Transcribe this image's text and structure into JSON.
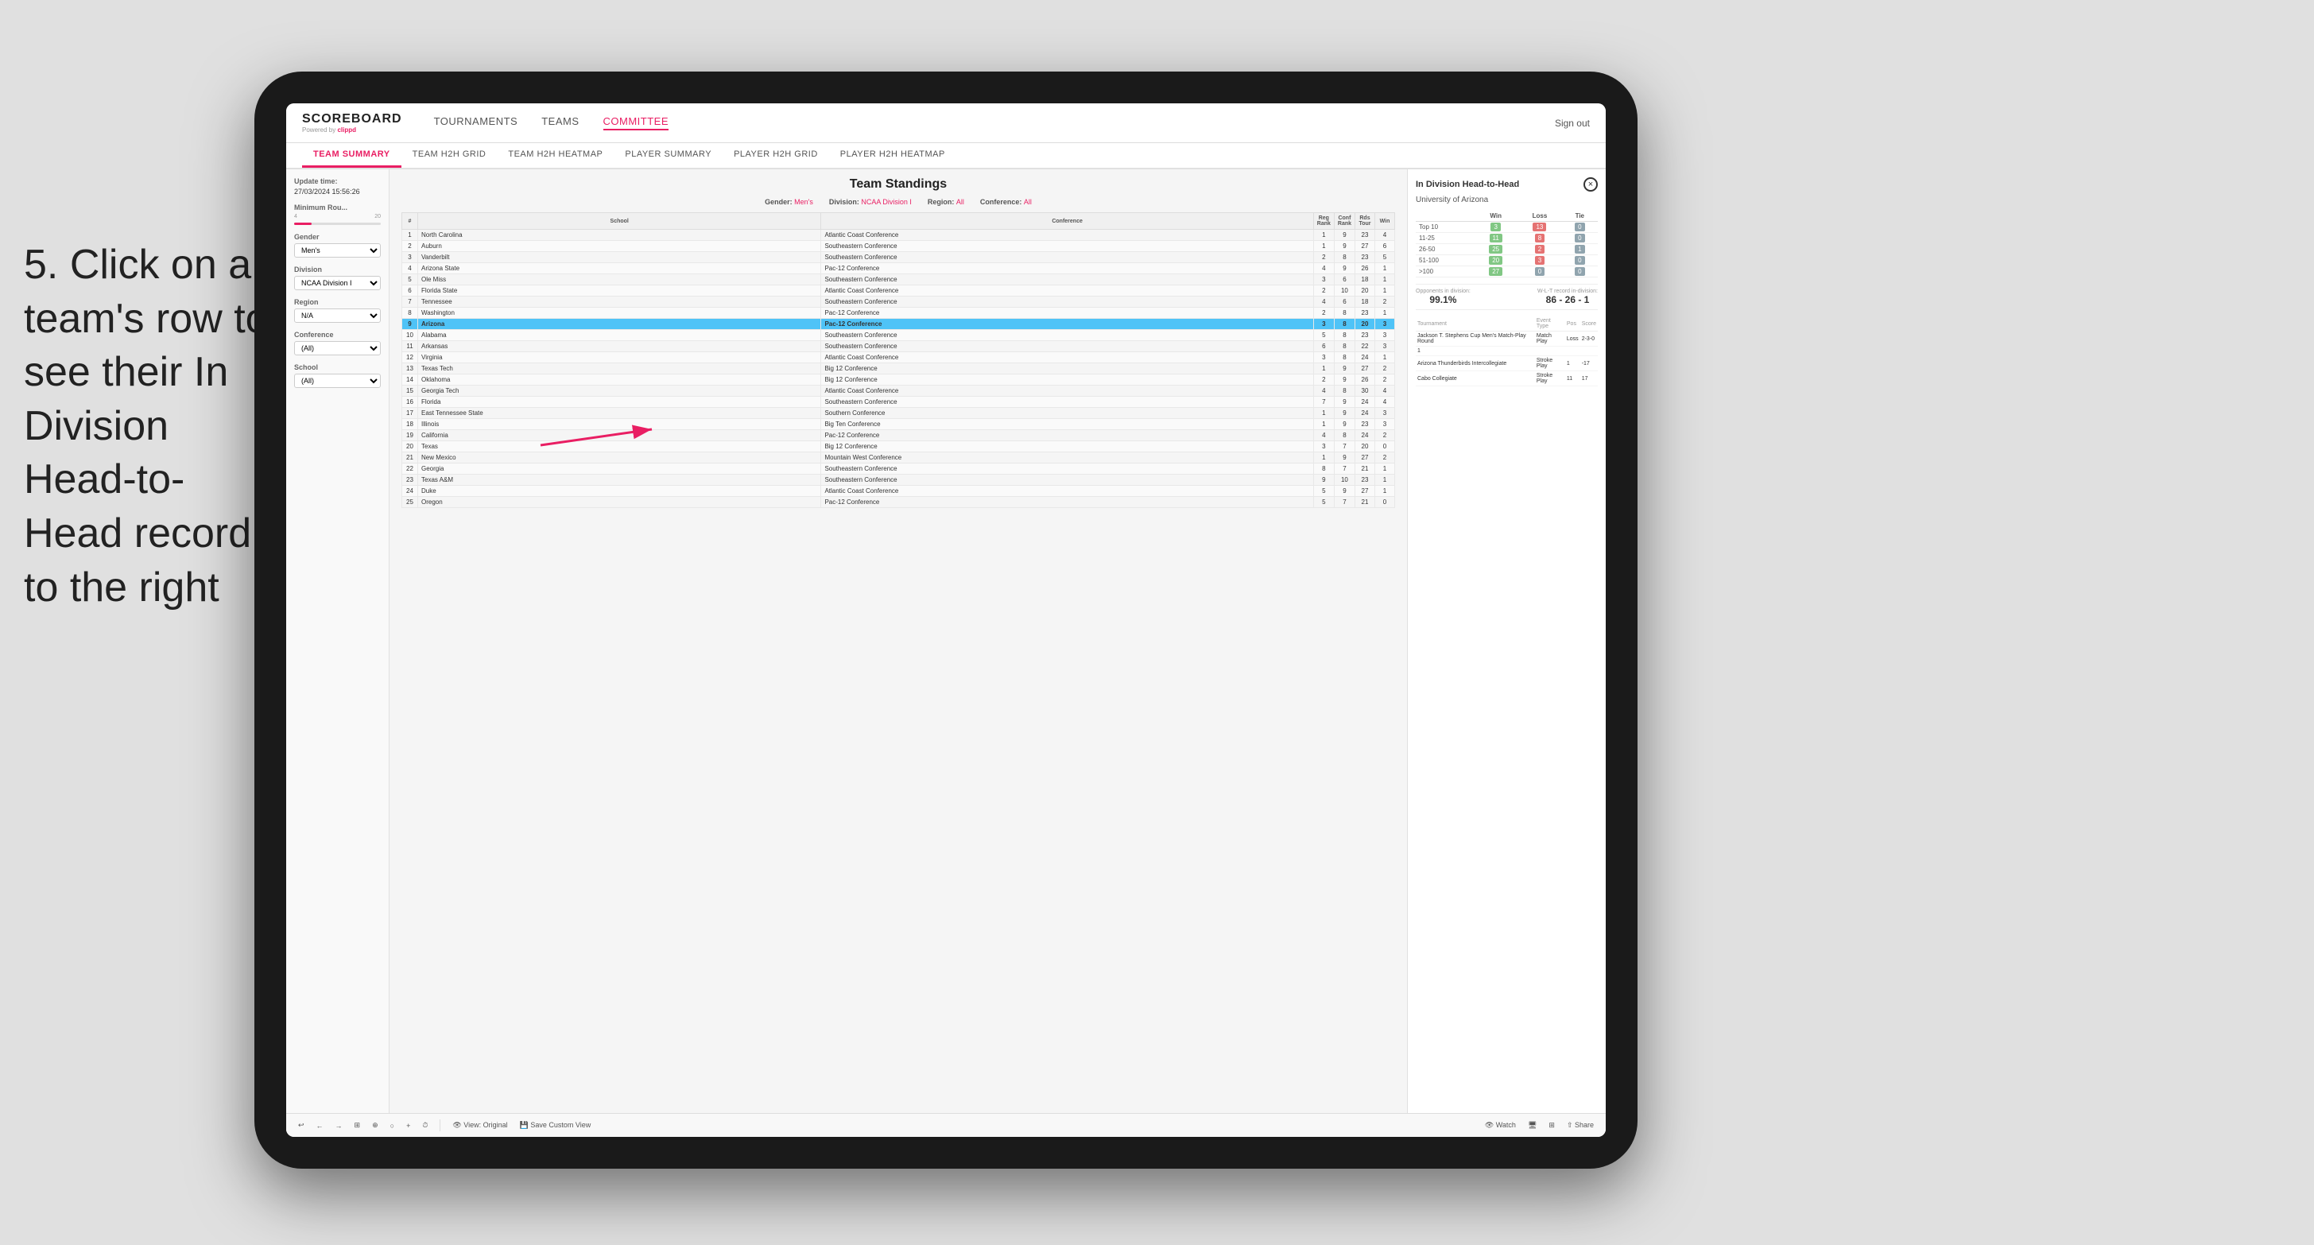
{
  "instruction": {
    "step": "5. Click on a team's row to see their In Division Head-to-Head record to the right"
  },
  "nav": {
    "logo": "SCOREBOARD",
    "logo_sub": "Powered by clippd",
    "links": [
      "TOURNAMENTS",
      "TEAMS",
      "COMMITTEE"
    ],
    "sign_out": "Sign out",
    "active_link": "COMMITTEE"
  },
  "sub_nav": {
    "items": [
      "TEAM SUMMARY",
      "TEAM H2H GRID",
      "TEAM H2H HEATMAP",
      "PLAYER SUMMARY",
      "PLAYER H2H GRID",
      "PLAYER H2H HEATMAP"
    ],
    "active": "TEAM SUMMARY"
  },
  "sidebar": {
    "update_label": "Update time:",
    "update_time": "27/03/2024 15:56:26",
    "min_rounds_label": "Minimum Rou...",
    "min_rounds_min": "4",
    "min_rounds_max": "20",
    "gender_label": "Gender",
    "gender_value": "Men's",
    "division_label": "Division",
    "division_value": "NCAA Division I",
    "region_label": "Region",
    "region_value": "N/A",
    "conference_label": "Conference",
    "conference_value": "(All)",
    "school_label": "School",
    "school_value": "(All)"
  },
  "standings": {
    "title": "Team Standings",
    "gender_label": "Gender:",
    "gender_value": "Men's",
    "division_label": "Division:",
    "division_value": "NCAA Division I",
    "region_label": "Region:",
    "region_value": "All",
    "conference_label": "Conference:",
    "conference_value": "All",
    "columns": [
      "#",
      "School",
      "Conference",
      "Reg Rank",
      "Conf Rank",
      "Rds Tour",
      "Win"
    ],
    "rows": [
      {
        "num": 1,
        "school": "North Carolina",
        "conf": "Atlantic Coast Conference",
        "reg_rank": 1,
        "conf_rank": 9,
        "rds": 23,
        "win": 4
      },
      {
        "num": 2,
        "school": "Auburn",
        "conf": "Southeastern Conference",
        "reg_rank": 1,
        "conf_rank": 9,
        "rds": 27,
        "win": 6
      },
      {
        "num": 3,
        "school": "Vanderbilt",
        "conf": "Southeastern Conference",
        "reg_rank": 2,
        "conf_rank": 8,
        "rds": 23,
        "win": 5
      },
      {
        "num": 4,
        "school": "Arizona State",
        "conf": "Pac-12 Conference",
        "reg_rank": 4,
        "conf_rank": 9,
        "rds": 26,
        "win": 1
      },
      {
        "num": 5,
        "school": "Ole Miss",
        "conf": "Southeastern Conference",
        "reg_rank": 3,
        "conf_rank": 6,
        "rds": 18,
        "win": 1
      },
      {
        "num": 6,
        "school": "Florida State",
        "conf": "Atlantic Coast Conference",
        "reg_rank": 2,
        "conf_rank": 10,
        "rds": 20,
        "win": 1
      },
      {
        "num": 7,
        "school": "Tennessee",
        "conf": "Southeastern Conference",
        "reg_rank": 4,
        "conf_rank": 6,
        "rds": 18,
        "win": 2
      },
      {
        "num": 8,
        "school": "Washington",
        "conf": "Pac-12 Conference",
        "reg_rank": 2,
        "conf_rank": 8,
        "rds": 23,
        "win": 1
      },
      {
        "num": 9,
        "school": "Arizona",
        "conf": "Pac-12 Conference",
        "reg_rank": 3,
        "conf_rank": 8,
        "rds": 20,
        "win": 3,
        "highlighted": true
      },
      {
        "num": 10,
        "school": "Alabama",
        "conf": "Southeastern Conference",
        "reg_rank": 5,
        "conf_rank": 8,
        "rds": 23,
        "win": 3
      },
      {
        "num": 11,
        "school": "Arkansas",
        "conf": "Southeastern Conference",
        "reg_rank": 6,
        "conf_rank": 8,
        "rds": 22,
        "win": 3
      },
      {
        "num": 12,
        "school": "Virginia",
        "conf": "Atlantic Coast Conference",
        "reg_rank": 3,
        "conf_rank": 8,
        "rds": 24,
        "win": 1
      },
      {
        "num": 13,
        "school": "Texas Tech",
        "conf": "Big 12 Conference",
        "reg_rank": 1,
        "conf_rank": 9,
        "rds": 27,
        "win": 2
      },
      {
        "num": 14,
        "school": "Oklahoma",
        "conf": "Big 12 Conference",
        "reg_rank": 2,
        "conf_rank": 9,
        "rds": 26,
        "win": 2
      },
      {
        "num": 15,
        "school": "Georgia Tech",
        "conf": "Atlantic Coast Conference",
        "reg_rank": 4,
        "conf_rank": 8,
        "rds": 30,
        "win": 4
      },
      {
        "num": 16,
        "school": "Florida",
        "conf": "Southeastern Conference",
        "reg_rank": 7,
        "conf_rank": 9,
        "rds": 24,
        "win": 4
      },
      {
        "num": 17,
        "school": "East Tennessee State",
        "conf": "Southern Conference",
        "reg_rank": 1,
        "conf_rank": 9,
        "rds": 24,
        "win": 3
      },
      {
        "num": 18,
        "school": "Illinois",
        "conf": "Big Ten Conference",
        "reg_rank": 1,
        "conf_rank": 9,
        "rds": 23,
        "win": 3
      },
      {
        "num": 19,
        "school": "California",
        "conf": "Pac-12 Conference",
        "reg_rank": 4,
        "conf_rank": 8,
        "rds": 24,
        "win": 2
      },
      {
        "num": 20,
        "school": "Texas",
        "conf": "Big 12 Conference",
        "reg_rank": 3,
        "conf_rank": 7,
        "rds": 20,
        "win": 0
      },
      {
        "num": 21,
        "school": "New Mexico",
        "conf": "Mountain West Conference",
        "reg_rank": 1,
        "conf_rank": 9,
        "rds": 27,
        "win": 2
      },
      {
        "num": 22,
        "school": "Georgia",
        "conf": "Southeastern Conference",
        "reg_rank": 8,
        "conf_rank": 7,
        "rds": 21,
        "win": 1
      },
      {
        "num": 23,
        "school": "Texas A&M",
        "conf": "Southeastern Conference",
        "reg_rank": 9,
        "conf_rank": 10,
        "rds": 23,
        "win": 1
      },
      {
        "num": 24,
        "school": "Duke",
        "conf": "Atlantic Coast Conference",
        "reg_rank": 5,
        "conf_rank": 9,
        "rds": 27,
        "win": 1
      },
      {
        "num": 25,
        "school": "Oregon",
        "conf": "Pac-12 Conference",
        "reg_rank": 5,
        "conf_rank": 7,
        "rds": 21,
        "win": 0
      }
    ]
  },
  "h2h": {
    "title": "In Division Head-to-Head",
    "team": "University of Arizona",
    "close_label": "×",
    "columns": [
      "",
      "Win",
      "Loss",
      "Tie"
    ],
    "rows": [
      {
        "range": "Top 10",
        "win": 3,
        "loss": 13,
        "tie": 0,
        "win_color": "green",
        "loss_color": "red",
        "tie_color": "gray"
      },
      {
        "range": "11-25",
        "win": 11,
        "loss": 8,
        "tie": 0,
        "win_color": "green",
        "loss_color": "red",
        "tie_color": "gray"
      },
      {
        "range": "26-50",
        "win": 25,
        "loss": 2,
        "tie": 1,
        "win_color": "green",
        "loss_color": "red",
        "tie_color": "gray"
      },
      {
        "range": "51-100",
        "win": 20,
        "loss": 3,
        "tie": 0,
        "win_color": "green",
        "loss_color": "red",
        "tie_color": "gray"
      },
      {
        "range": ">100",
        "win": 27,
        "loss": 0,
        "tie": 0,
        "win_color": "green",
        "loss_color": "gray",
        "tie_color": "gray"
      }
    ],
    "opponents_label": "Opponents in division:",
    "opponents_value": "99.1%",
    "record_label": "W-L-T record in-division:",
    "record_value": "86 - 26 - 1",
    "tournament_label": "Tournament",
    "tournament_columns": [
      "Tournament",
      "Event Type",
      "Pos",
      "Score"
    ],
    "tournaments": [
      {
        "name": "Jackson T. Stephens Cup Men's Match-Play Round",
        "type": "Match Play",
        "result": "Loss",
        "pos": "2-3-0"
      },
      {
        "name": "1",
        "type": "",
        "pos": "",
        "score": ""
      },
      {
        "name": "Arizona Thunderbirds Intercollegiate",
        "type": "Stroke Play",
        "pos": "1",
        "score": "-17"
      },
      {
        "name": "Cabo Collegiate",
        "type": "Stroke Play",
        "pos": "11",
        "score": "17"
      }
    ]
  },
  "toolbar": {
    "buttons": [
      "↩",
      "←",
      "→",
      "⊞",
      "⊕",
      "○",
      "+",
      "⏱"
    ],
    "view_original": "View: Original",
    "save_custom": "Save Custom View",
    "watch": "Watch",
    "icons_right": [
      "👁",
      "⬛",
      "⬛",
      "Share"
    ]
  }
}
